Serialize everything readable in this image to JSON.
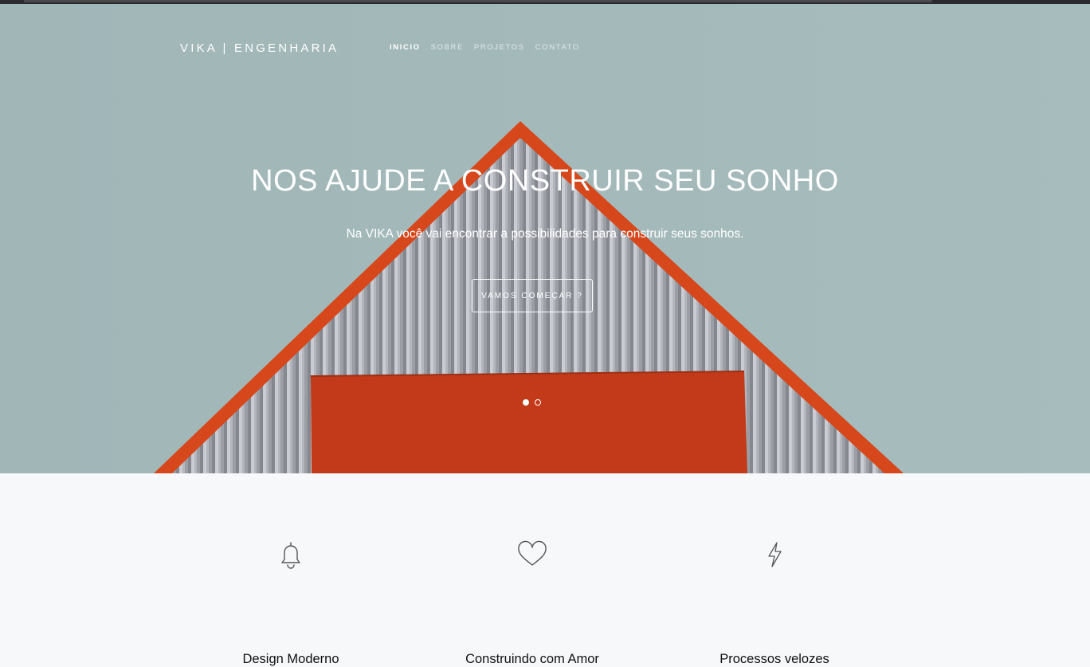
{
  "brand": "VIKA  |  ENGENHARIA",
  "nav": [
    {
      "label": "INICIO",
      "active": true
    },
    {
      "label": "SOBRE",
      "active": false
    },
    {
      "label": "PROJETOS",
      "active": false
    },
    {
      "label": "CONTATO",
      "active": false
    }
  ],
  "hero": {
    "headline": "NOS AJUDE A CONSTRUIR SEU SONHO",
    "subtitle": "Na VIKA você vai encontrar a possibilidades para construir seus sonhos.",
    "cta_label": "VAMOS COMEÇAR ?",
    "slide_count": 2,
    "active_slide": 1
  },
  "features": [
    {
      "icon": "bell-icon",
      "title": "Design Moderno"
    },
    {
      "icon": "heart-icon",
      "title": "Construindo com Amor"
    },
    {
      "icon": "lightning-icon",
      "title": "Processos velozes"
    }
  ],
  "colors": {
    "sky": "#a2b8b9",
    "roof_orange": "#d9461a",
    "door_orange": "#c2391a",
    "wall_grey": "#9a9ca5",
    "section_bg": "#f7f8fa"
  }
}
